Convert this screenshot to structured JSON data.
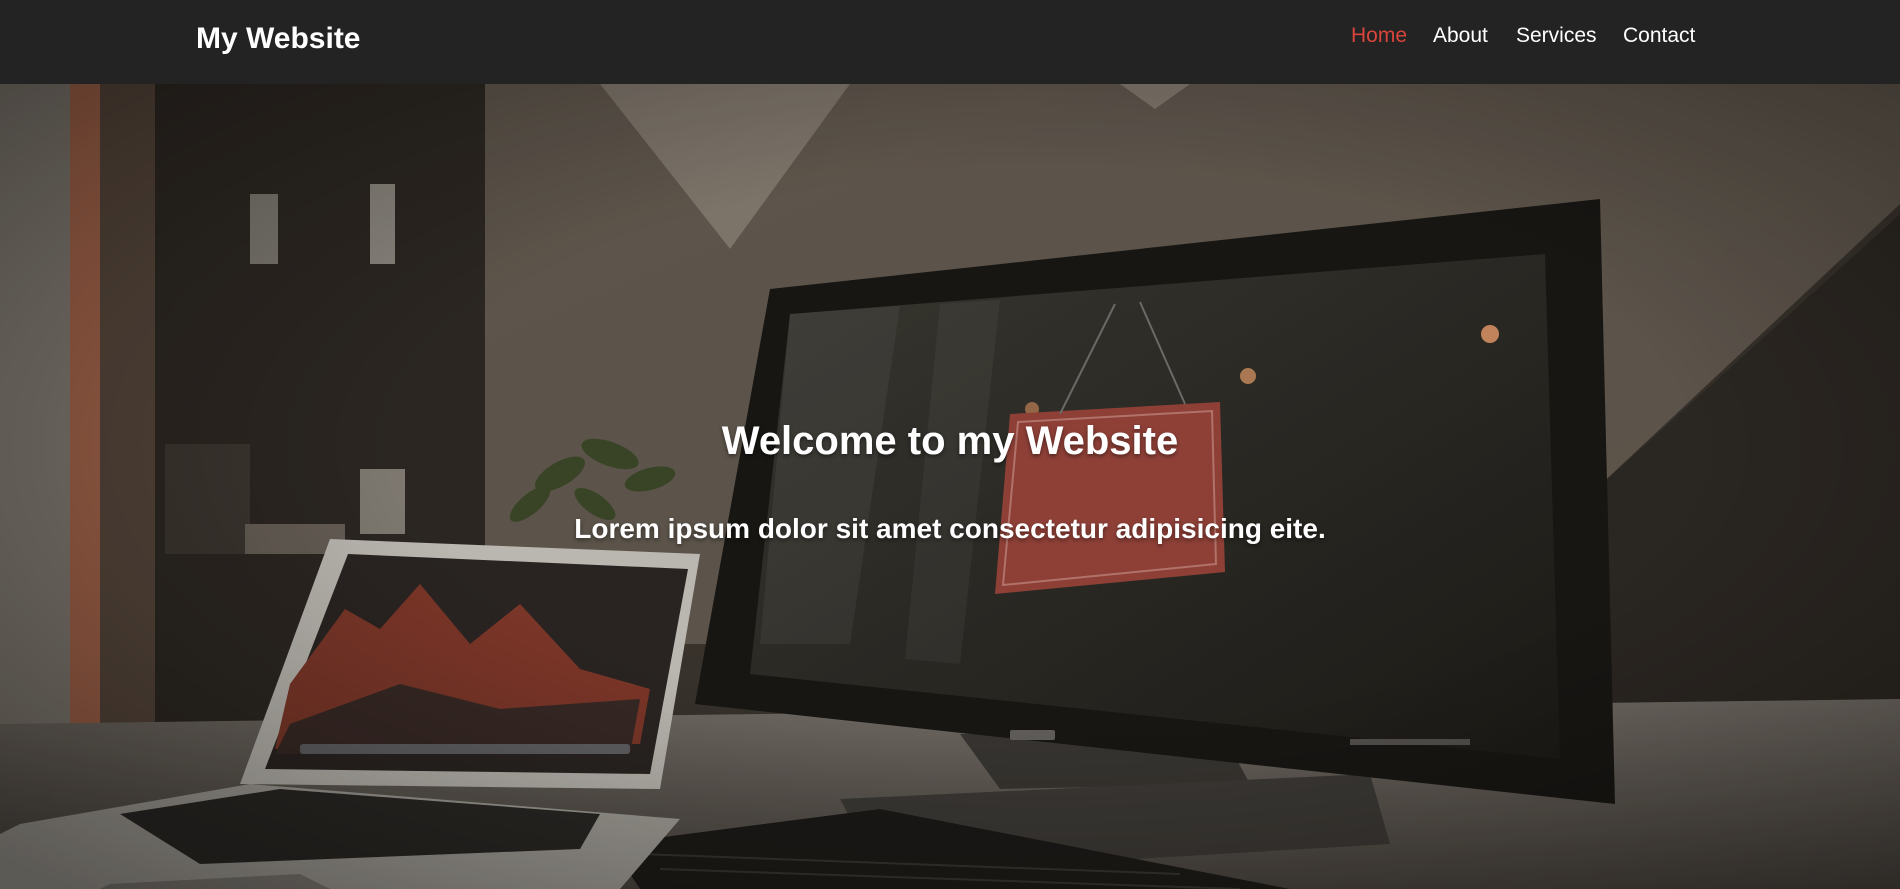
{
  "site": {
    "logo": "My Website"
  },
  "nav": {
    "items": [
      {
        "label": "Home",
        "active": true
      },
      {
        "label": "About",
        "active": false
      },
      {
        "label": "Services",
        "active": false
      },
      {
        "label": "Contact",
        "active": false
      }
    ],
    "active_color": "#d9443b"
  },
  "hero": {
    "title": "Welcome to my Website",
    "subtitle": "Lorem ipsum dolor sit amet consectetur adipisicing eite."
  },
  "colors": {
    "navbar_bg": "#232323",
    "text": "#ffffff"
  }
}
